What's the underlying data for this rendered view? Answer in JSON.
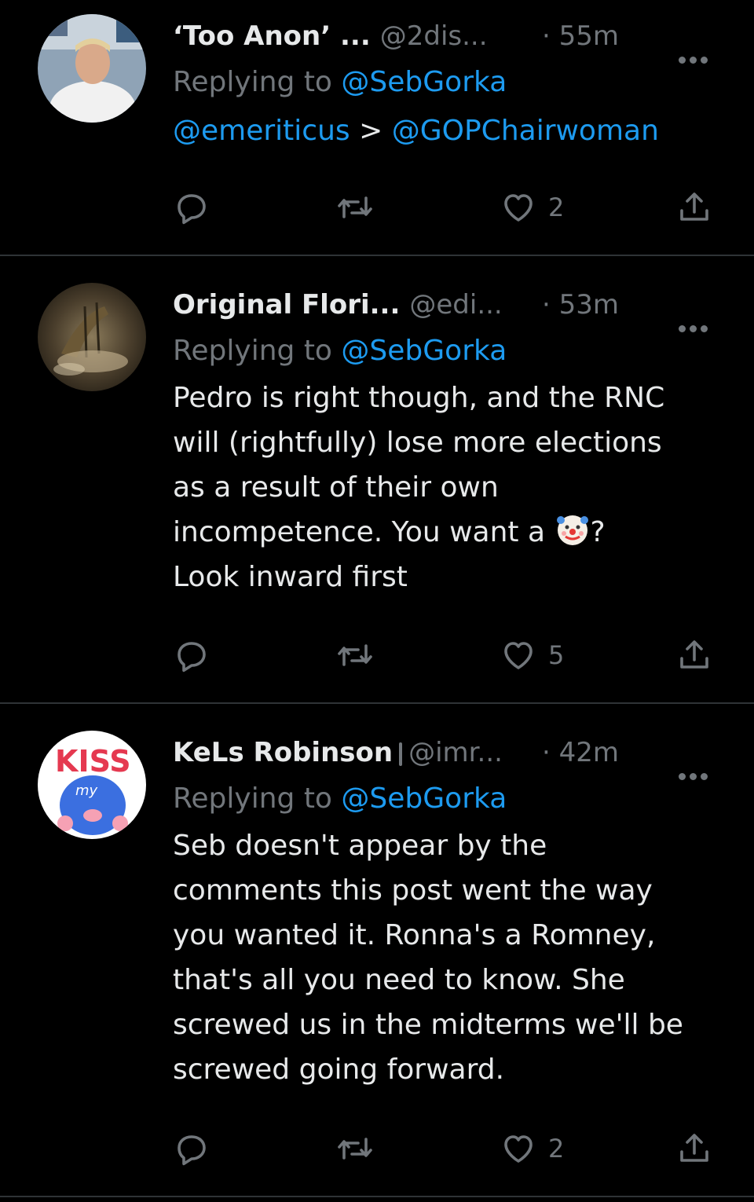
{
  "colors": {
    "background": "#000000",
    "text_primary": "#e7e9ea",
    "text_secondary": "#71767b",
    "link": "#1d9bf0",
    "divider": "#2f3336"
  },
  "tweets": [
    {
      "display_name": "‘Too Anon’ ...",
      "handle": "@2dis...",
      "time": "· 55m",
      "reply_prefix": "Replying to",
      "reply_mention": "@SebGorka",
      "mention_1": "@emeriticus",
      "separator": ">",
      "mention_2": "@GOPChairwoman",
      "like_count": "2",
      "avatar_icon": "profile-photo"
    },
    {
      "display_name": "Original Flori...",
      "handle": "@edi...",
      "time": "· 53m",
      "reply_prefix": "Replying to",
      "reply_mention": "@SebGorka",
      "body_lines": [
        "Pedro is right though, and the RNC",
        "will (rightfully) lose more elections",
        "as a result of their own",
        "incompetence. You want a",
        "?",
        "Look inward first"
      ],
      "like_count": "5",
      "avatar_icon": "painting-avatar"
    },
    {
      "display_name": "KeLs Robinson",
      "handle": "@imr...",
      "time": "· 42m",
      "reply_prefix": "Replying to",
      "reply_mention": "@SebGorka",
      "avatar_text_1": "KISS",
      "avatar_text_2": "my",
      "body_lines": [
        "Seb doesn't appear by the",
        "comments this post went the way",
        "you wanted it. Ronna's a Romney,",
        "that's all you need to know. She",
        "screwed us in the midterms we'll be",
        "screwed going forward."
      ],
      "like_count": "2",
      "avatar_icon": "kiss-my-avatar"
    }
  ],
  "icons": {
    "reply": "reply-icon",
    "retweet": "retweet-icon",
    "like": "heart-icon",
    "share": "share-icon",
    "more": "more-options-icon",
    "clown": "clown-emoji-icon"
  }
}
